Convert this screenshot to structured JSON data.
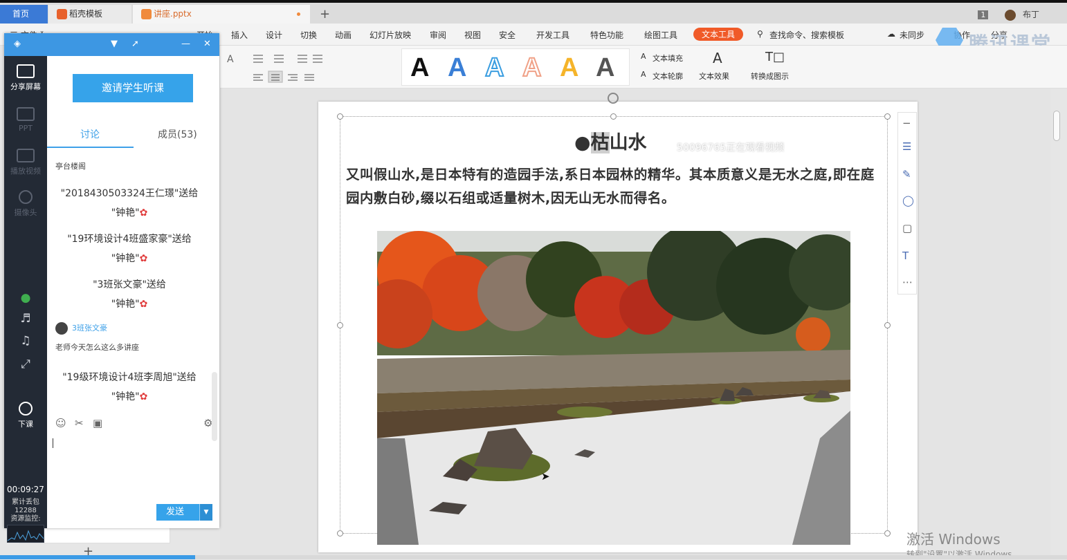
{
  "tabs": {
    "home": "首页",
    "template": "稻壳模板",
    "doc": "讲座.pptx"
  },
  "user": {
    "badge": "1",
    "name": "布丁"
  },
  "menu": {
    "file": "三 文件 ˅",
    "start": "开始",
    "items": [
      "插入",
      "设计",
      "切换",
      "动画",
      "幻灯片放映",
      "审阅",
      "视图",
      "安全",
      "开发工具",
      "特色功能",
      "绘图工具"
    ],
    "active": "文本工具",
    "search": "查找命令、搜索模板",
    "sync": "未同步",
    "collab": "协作",
    "share": "分享"
  },
  "ribbon": {
    "wordart_letter": "A",
    "text_fill": "文本填充",
    "text_outline": "文本轮廓",
    "text_effect": "文本效果",
    "convert": "转换成图示",
    "wordart_colors": [
      "#111111",
      "#3a7fd6",
      "#3a9de0",
      "#f0a187",
      "#f5b42a",
      "#555555"
    ]
  },
  "slide": {
    "title_bullet": "●",
    "title_hl": "枯",
    "title_rest": "山水",
    "body": "又叫假山水,是日本特有的造园手法,系日本园林的精华。其本质意义是无水之庭,即在庭园内敷白砂,缀以石组或适量树木,因无山无水而得名。",
    "watermark": "50096765正在观看视频"
  },
  "tencent": {
    "logo": "腾讯课堂"
  },
  "windows": {
    "line1": "激活 Windows",
    "line2": "转到\"设置\"以激活 Windows。"
  },
  "panel": {
    "invite": "邀请学生听课",
    "tab_discuss": "讨论",
    "tab_members": "成员(53)",
    "nav": {
      "share": "分享屏幕",
      "ppt": "PPT",
      "video": "播放视频",
      "camera": "摄像头",
      "end": "下课"
    },
    "timer": "00:09:27",
    "stats_label": "累计丢包",
    "stats_value": "12288",
    "monitor": "资源监控:",
    "send": "发送",
    "messages": {
      "m0_text": "亭台楼阁",
      "g1_line1": "\"2018430503324王仁璟\"送给",
      "g1_line2": "\"钟艳\"",
      "g2_line1": "\"19环境设计4班盛家豪\"送给",
      "g2_line2": "\"钟艳\"",
      "g3_line1": "\"3班张文豪\"送给",
      "g3_line2": "\"钟艳\"",
      "m4_name": "3班张文豪",
      "m4_text": "老师今天怎么这么多讲座",
      "g5_line1": "\"19级环境设计4班李周旭\"送给",
      "g5_line2": "\"钟艳\""
    }
  }
}
